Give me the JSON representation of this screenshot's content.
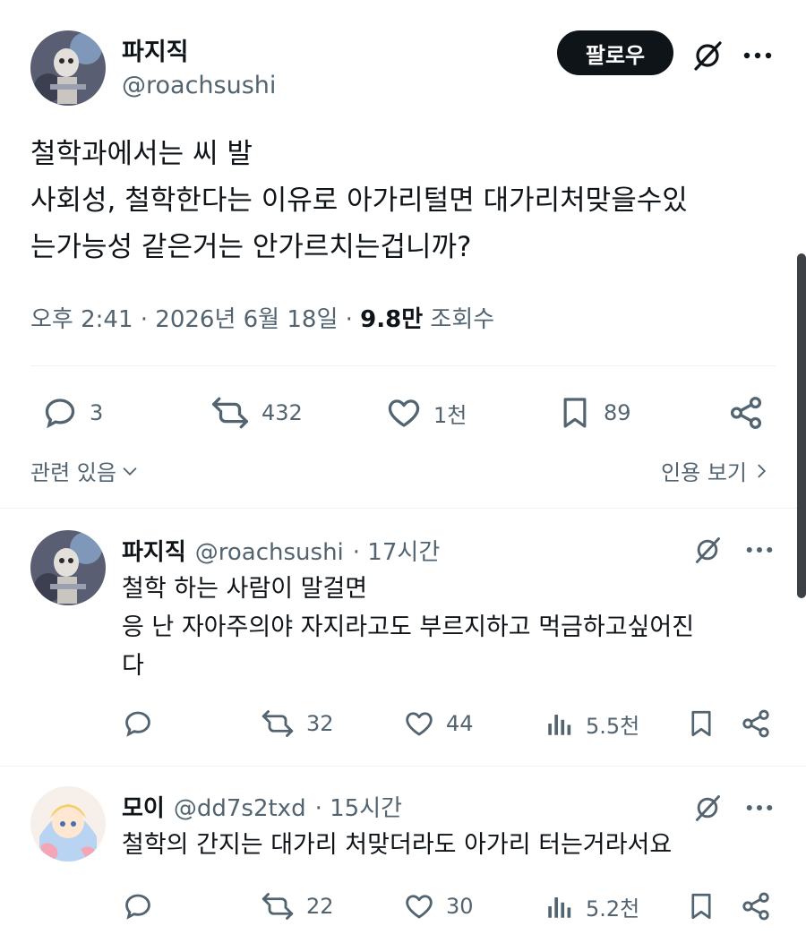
{
  "main_tweet": {
    "display_name": "파지직",
    "handle": "@roachsushi",
    "follow_label": "팔로우",
    "text_lines": [
      "철학과에서는 씨 발",
      "사회성, 철학한다는 이유로 아가리털면 대가리처맞을수있",
      "는가능성 같은거는 안가르치는겁니까?"
    ],
    "time": "오후 2:41 · 2026년 6월 18일 ·",
    "views_count": "9.8만",
    "views_label": "조회수",
    "replies": "3",
    "reposts": "432",
    "likes": "1천",
    "bookmarks": "89",
    "related_label": "관련 있음",
    "quotes_label": "인용 보기"
  },
  "replies": [
    {
      "display_name": "파지직",
      "handle": "@roachsushi",
      "time": "· 17시간",
      "text_lines": [
        "철학 하는 사람이 말걸면",
        "응 난 자아주의야 자지라고도 부르지하고 먹금하고싶어진",
        "다"
      ],
      "reposts": "32",
      "likes": "44",
      "views": "5.5천"
    },
    {
      "display_name": "모이",
      "handle": "@dd7s2txd",
      "time": "· 15시간",
      "text_lines": [
        "철학의 간지는 대가리 처맞더라도 아가리 터는거라서요"
      ],
      "reposts": "22",
      "likes": "30",
      "views": "5.2천"
    }
  ],
  "colors": {
    "text": "#0f1419",
    "secondary": "#536471",
    "divider": "#eff3f4",
    "follow_bg": "#0f1419"
  }
}
